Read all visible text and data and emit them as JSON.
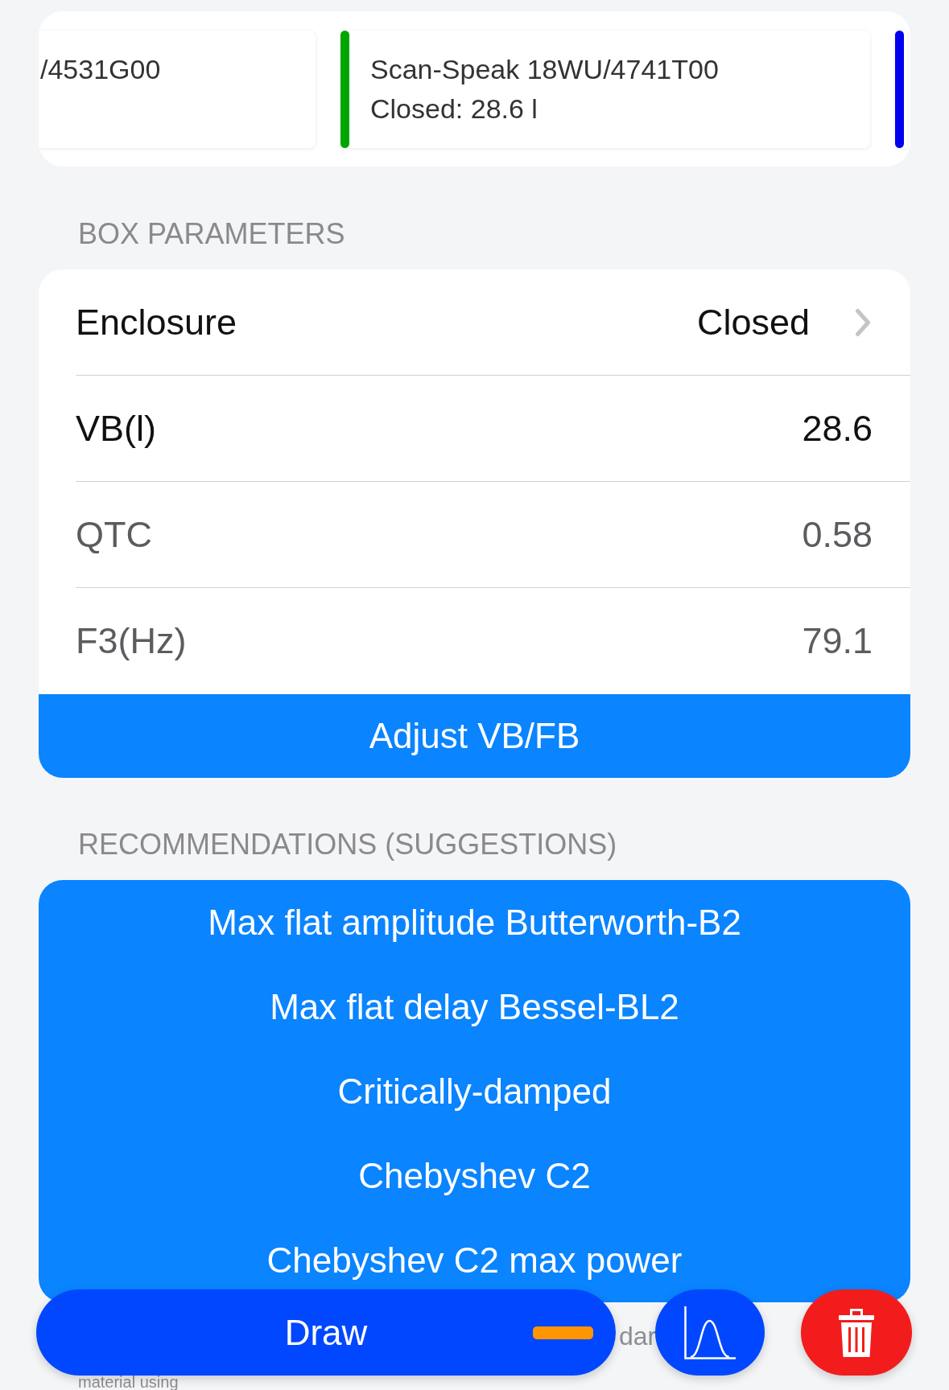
{
  "driver_cards": [
    {
      "title": "/4531G00"
    },
    {
      "title": "Scan-Speak 18WU/4741T00",
      "detail": "Closed: 28.6 l",
      "color": "#00a600"
    },
    {
      "color": "#0000ee"
    }
  ],
  "box_parameters": {
    "header": "BOX PARAMETERS",
    "rows": [
      {
        "kind": "picker",
        "label": "Enclosure",
        "value": "Closed",
        "editable": true
      },
      {
        "kind": "value",
        "label": "VB(l)",
        "value": "28.6",
        "editable": true
      },
      {
        "kind": "value",
        "label": "QTC",
        "value": "0.58",
        "editable": false
      },
      {
        "kind": "value",
        "label": "F3(Hz)",
        "value": "79.1",
        "editable": false
      }
    ],
    "button": "Adjust VB/FB"
  },
  "recommendations": {
    "header": "RECOMMENDATIONS (SUGGESTIONS)",
    "items": [
      "Max flat amplitude Butterworth-B2",
      "Max flat delay Bessel-BL2",
      "Critically-damped",
      "Chebyshev C2",
      "Chebyshev C2 max power"
    ]
  },
  "covered_text": [
    "dar",
    "material using"
  ],
  "bottom_bar": {
    "draw_button": "Draw"
  }
}
